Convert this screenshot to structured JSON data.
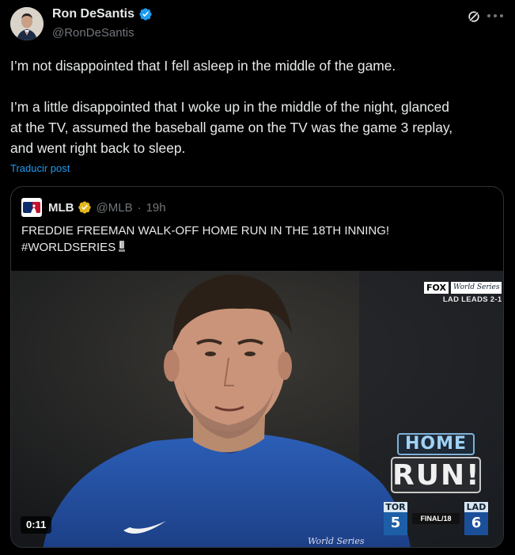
{
  "author": {
    "name": "Ron DeSantis",
    "handle": "@RonDeSantis",
    "avatar_icon": "user-avatar",
    "verified_color": "#1d9bf0"
  },
  "tweet": {
    "paragraph1": "I’m not disappointed that I fell asleep in the middle of the game.",
    "paragraph2": "I’m a little disappointed that I woke up in the middle of the night, glanced\nat the TV, assumed the baseball game on the TV was the game 3 replay,\nand went right back to sleep.",
    "translate_label": "Traducir post"
  },
  "quoted": {
    "name": "MLB",
    "handle": "@MLB",
    "separator": "·",
    "age": "19h",
    "text_line1": "FREDDIE FREEMAN WALK-OFF HOME RUN IN THE 18TH INNING!",
    "text_line2": "#WORLDSERIES",
    "badge_color": "#e2b719",
    "video": {
      "duration": "0:11",
      "network": "FOX",
      "series_logo": "World Series",
      "series_status": "LAD LEADS 2-1",
      "graphic_top": "HOME",
      "graphic_bottom": "RUN!",
      "away_team": "TOR",
      "away_score": "5",
      "home_team": "LAD",
      "home_score": "6",
      "game_status": "FINAL/18"
    }
  }
}
